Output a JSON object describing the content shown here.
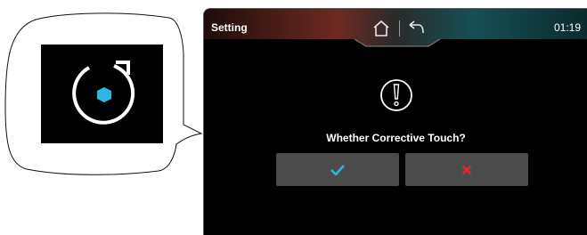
{
  "screen": {
    "title": "Setting",
    "clock": "01:19"
  },
  "dialog": {
    "prompt": "Whether Corrective Touch?",
    "confirm_icon": "checkmark-icon",
    "cancel_icon": "cross-icon"
  },
  "callout": {
    "icon": "recalibrate-touch-icon"
  },
  "colors": {
    "accent_cyan": "#29b9e0",
    "cancel_red": "#e32630",
    "button_gray": "#4b4b4b",
    "status_red_tint": "#6e2a22",
    "status_teal_tint": "#164f55"
  }
}
